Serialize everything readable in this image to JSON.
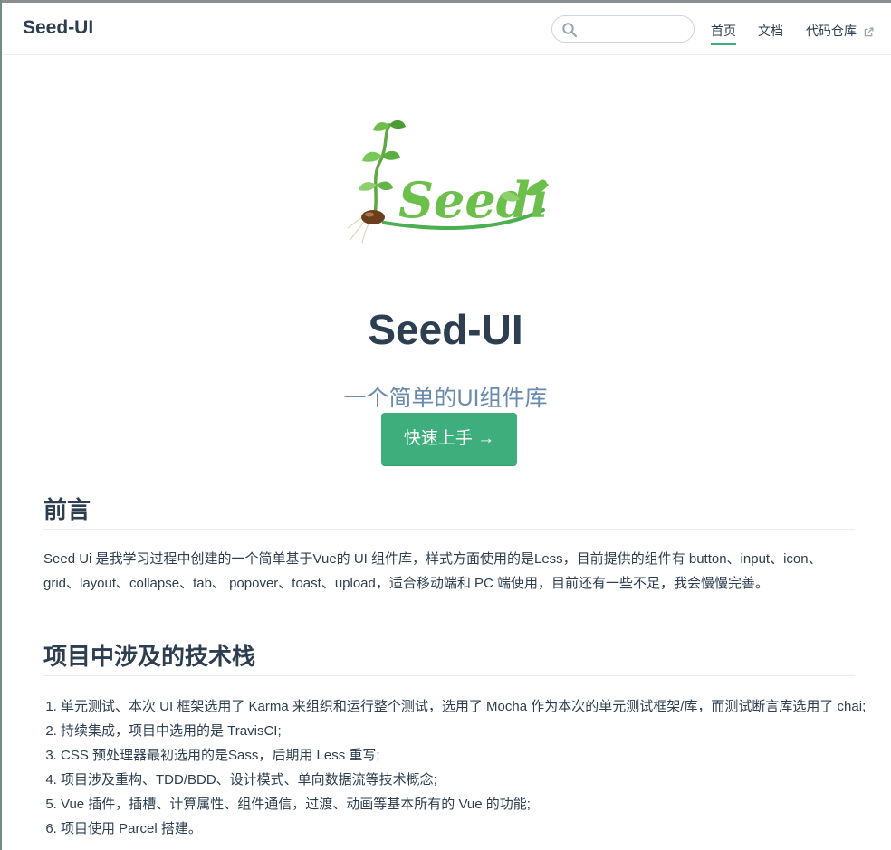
{
  "navbar": {
    "site_name": "Seed-UI",
    "search": {
      "value": "",
      "placeholder": ""
    },
    "links": [
      {
        "label": "首页"
      },
      {
        "label": "文档"
      },
      {
        "label": "代码仓库"
      }
    ]
  },
  "hero": {
    "logo_text": "Seedi",
    "title": "Seed-UI",
    "description": "一个简单的UI组件库",
    "action_label": "快速上手 →"
  },
  "sections": {
    "preface": {
      "heading": "前言",
      "text": "Seed Ui 是我学习过程中创建的一个简单基于Vue的 UI 组件库，样式方面使用的是Less，目前提供的组件有 button、input、icon、grid、layout、collapse、tab、 popover、toast、upload，适合移动端和 PC 端使用，目前还有一些不足，我会慢慢完善。"
    },
    "tech_stack": {
      "heading": "项目中涉及的技术栈",
      "items": [
        "单元测试、本次 UI 框架选用了 Karma 来组织和运行整个测试，选用了 Mocha 作为本次的单元测试框架/库，而测试断言库选用了 chai;",
        "持续集成，项目中选用的是 TravisCI;",
        "CSS 预处理器最初选用的是Sass，后期用 Less 重写;",
        "项目涉及重构、TDD/BDD、设计模式、单向数据流等技术概念;",
        "Vue 插件，插槽、计算属性、组件通信，过渡、动画等基本所有的 Vue 的功能;",
        "项目使用 Parcel 搭建。"
      ]
    }
  },
  "colors": {
    "accent": "#3eaf7c",
    "text": "#2c3e50",
    "hero_desc": "#6a8bad",
    "border": "#eaecef"
  },
  "icons": [
    "search-icon",
    "external-link-icon",
    "seed-logo"
  ]
}
